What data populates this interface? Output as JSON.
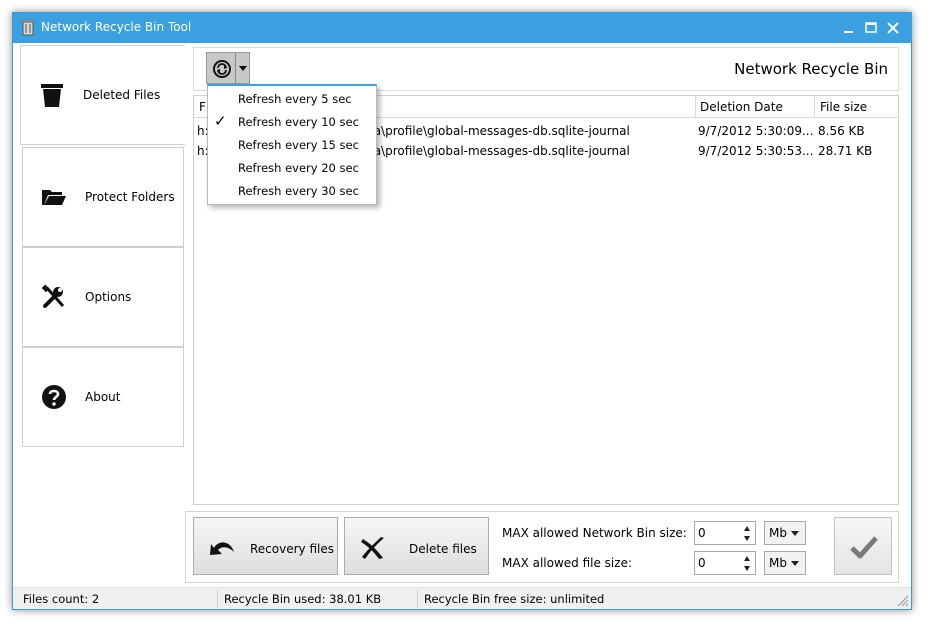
{
  "window": {
    "title": "Network Recycle Bin Tool",
    "accent": "#3aa0e0"
  },
  "sidebar": {
    "items": [
      {
        "label": "Deleted Files",
        "icon": "trash-bin-icon"
      },
      {
        "label": "Protect Folders",
        "icon": "folder-open-icon"
      },
      {
        "label": "Options",
        "icon": "tools-icon"
      },
      {
        "label": "About",
        "icon": "question-icon"
      }
    ]
  },
  "content": {
    "title": "Network Recycle Bin"
  },
  "refresh_menu": {
    "items": [
      {
        "label": "Refresh every 5 sec",
        "checked": false
      },
      {
        "label": "Refresh every 10 sec",
        "checked": true
      },
      {
        "label": "Refresh every 15 sec",
        "checked": false
      },
      {
        "label": "Refresh every 20 sec",
        "checked": false
      },
      {
        "label": "Refresh every 30 sec",
        "checked": false
      }
    ],
    "check_mark": "✓"
  },
  "table": {
    "columns": {
      "file": "F",
      "date": "Deletion Date",
      "size": "File size"
    },
    "rows": [
      {
        "path_start": "h:",
        "path_end": "ta\\profile\\global-messages-db.sqlite-journal",
        "date": "9/7/2012 5:30:09...",
        "size": "8.56 KB"
      },
      {
        "path_start": "h:",
        "path_end": "ta\\profile\\global-messages-db.sqlite-journal",
        "date": "9/7/2012 5:30:53...",
        "size": "28.71 KB"
      }
    ]
  },
  "actions": {
    "recovery": "Recovery files",
    "delete": "Delete files"
  },
  "settings": {
    "bin_size_label": "MAX allowed Network Bin size:",
    "bin_size_value": "0",
    "bin_size_unit": "Mb",
    "file_size_label": "MAX allowed file size:",
    "file_size_value": "0",
    "file_size_unit": "Mb"
  },
  "status": {
    "files_count": "Files count: 2",
    "used": "Recycle Bin used: 38.01 KB",
    "free": "Recycle Bin free size: unlimited"
  }
}
